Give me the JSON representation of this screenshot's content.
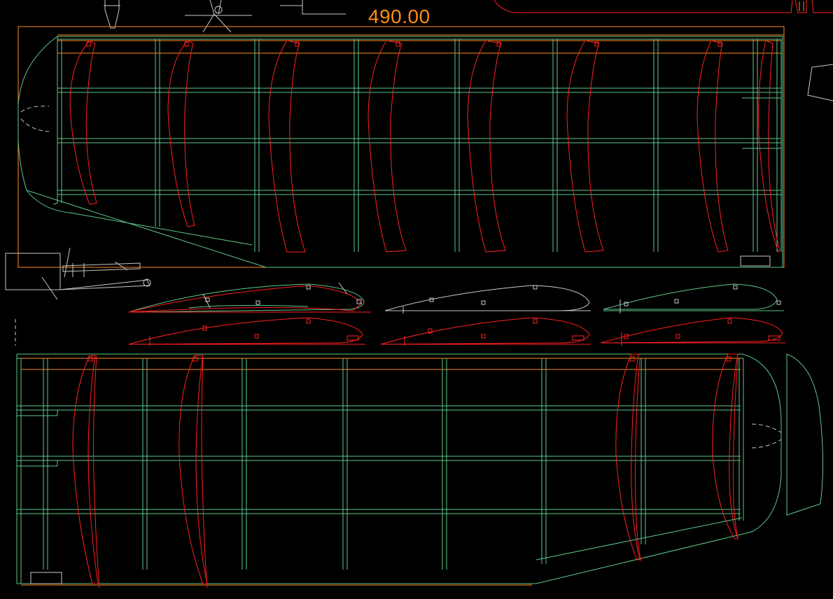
{
  "drawing": {
    "dimension_label": "490.00",
    "colors": {
      "background": "#000000",
      "structure": "#5ec98a",
      "rib": "#ff2020",
      "dimension": "#ff8c1a",
      "reference": "#c8c8c8"
    }
  }
}
